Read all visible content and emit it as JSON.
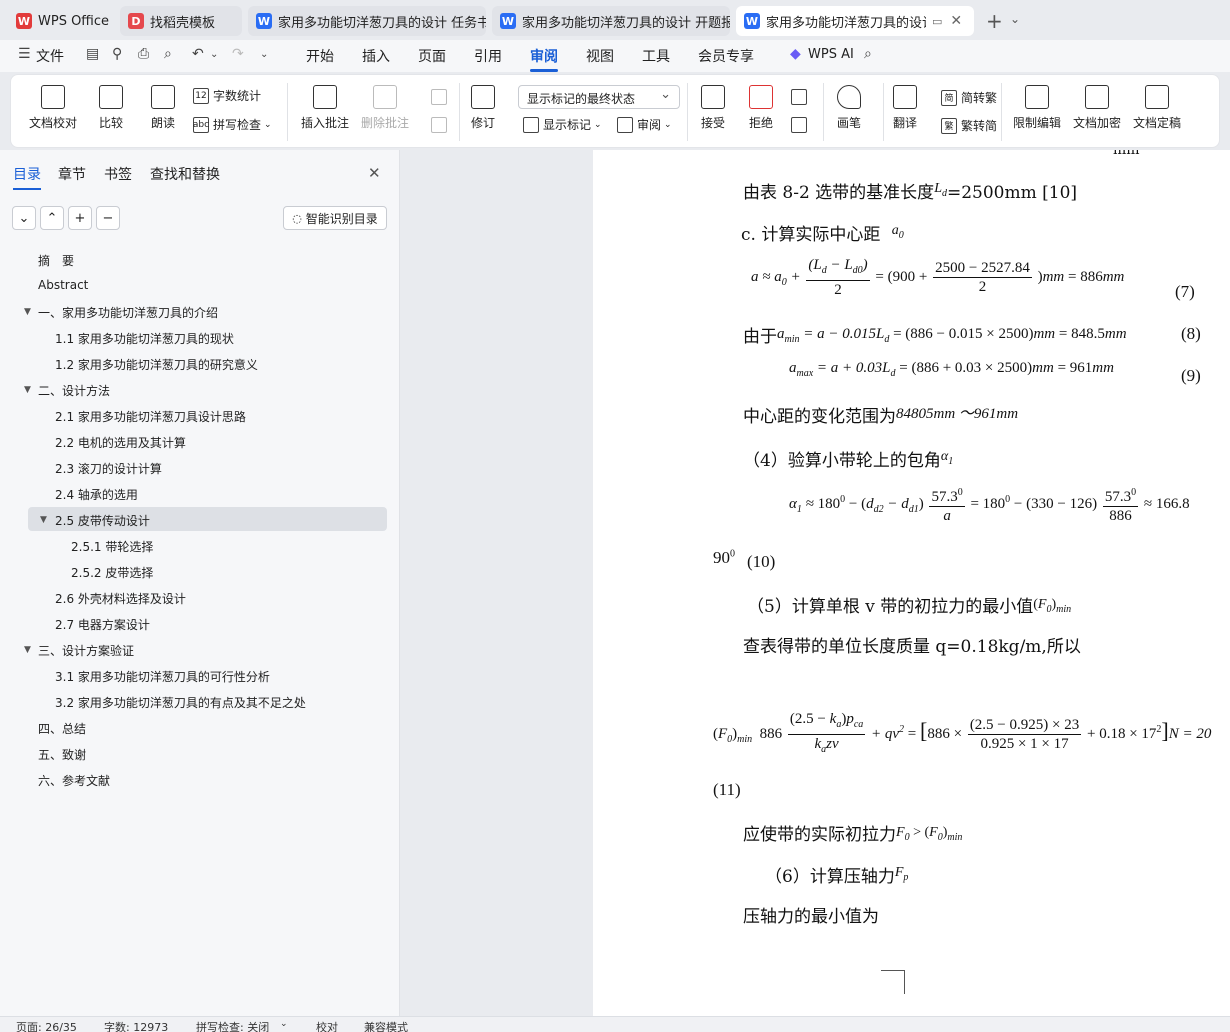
{
  "tabs": [
    {
      "label": "WPS Office"
    },
    {
      "label": "找稻壳模板"
    },
    {
      "label": "家用多功能切洋葱刀具的设计 任务书"
    },
    {
      "label": "家用多功能切洋葱刀具的设计 开题报"
    },
    {
      "label": "家用多功能切洋葱刀具的设计"
    }
  ],
  "menu": {
    "file": "文件",
    "items": [
      "开始",
      "插入",
      "页面",
      "引用",
      "审阅",
      "视图",
      "工具",
      "会员专享"
    ],
    "active": "审阅",
    "wps_ai": "WPS AI"
  },
  "ribbon": {
    "doc_check": "文档校对",
    "compare": "比较",
    "read_aloud": "朗读",
    "word_count": "字数统计",
    "spell_check": "拼写检查",
    "insert_comment": "插入批注",
    "delete_comment": "删除批注",
    "track_changes": "修订",
    "markup_state": "显示标记的最终状态",
    "show_markup": "显示标记",
    "review": "审阅",
    "accept": "接受",
    "reject": "拒绝",
    "pen": "画笔",
    "translate": "翻译",
    "to_traditional": "简转繁",
    "to_simplified": "繁转简",
    "restrict_edit": "限制编辑",
    "encrypt": "文档加密",
    "finalize": "文档定稿"
  },
  "nav": {
    "tabs": [
      "目录",
      "章节",
      "书签",
      "查找和替换"
    ],
    "smart_toc": "智能识别目录",
    "toc": [
      {
        "label": "摘　要",
        "level": 1
      },
      {
        "label": "Abstract",
        "level": 1
      },
      {
        "label": "一、家用多功能切洋葱刀具的介绍",
        "level": 1,
        "expanded": true
      },
      {
        "label": "1.1 家用多功能切洋葱刀具的现状",
        "level": 2
      },
      {
        "label": "1.2 家用多功能切洋葱刀具的研究意义",
        "level": 2
      },
      {
        "label": "二、设计方法",
        "level": 1,
        "expanded": true
      },
      {
        "label": "2.1 家用多功能切洋葱刀具设计思路",
        "level": 2
      },
      {
        "label": "2.2 电机的选用及其计算",
        "level": 2
      },
      {
        "label": "2.3 滚刀的设计计算",
        "level": 2
      },
      {
        "label": "2.4 轴承的选用",
        "level": 2
      },
      {
        "label": "2.5 皮带传动设计",
        "level": 2,
        "expanded": true,
        "selected": true
      },
      {
        "label": "2.5.1 带轮选择",
        "level": 3
      },
      {
        "label": "2.5.2 皮带选择",
        "level": 3
      },
      {
        "label": "2.6 外壳材料选择及设计",
        "level": 2
      },
      {
        "label": "2.7 电器方案设计",
        "level": 2
      },
      {
        "label": "三、设计方案验证",
        "level": 1,
        "expanded": true
      },
      {
        "label": "3.1 家用多功能切洋葱刀具的可行性分析",
        "level": 2
      },
      {
        "label": "3.2 家用多功能切洋葱刀具的有点及其不足之处",
        "level": 2
      },
      {
        "label": "四、总结",
        "level": 1
      },
      {
        "label": "五、致谢",
        "level": 1
      },
      {
        "label": "六、参考文献",
        "level": 1
      }
    ]
  },
  "doc": {
    "top_fragment": "mm",
    "l1": "由表 8-2 选带的基准长度",
    "l1b": "=2500mm [10]",
    "l2": "c.  计算实际中心距",
    "eq7_num": "(7)",
    "eq8_pre": "由于",
    "eq8_num": "(8)",
    "eq9_num": "(9)",
    "l_range": "中心距的变化范围为",
    "l_range_val": "84805mm ～961mm",
    "l4": "（4）验算小带轮上的包角",
    "eq10_tail": "166.8",
    "eq10_pre": "90",
    "eq10_num": "(10)",
    "l5": "（5）计算单根 v 带的初拉力的最小值",
    "l6": "查表得带的单位长度质量 q=0.18kg/m,所以",
    "eq11_tail": "N = 20",
    "eq11_num": "(11)",
    "l7": "应使带的实际初拉力",
    "l8": "（6）计算压轴力",
    "l9": "压轴力的最小值为"
  },
  "status": {
    "page": "页面: 26/35",
    "words": "字数: 12973",
    "spell": "拼写检查: 关闭",
    "proof": "校对",
    "compat": "兼容模式"
  }
}
